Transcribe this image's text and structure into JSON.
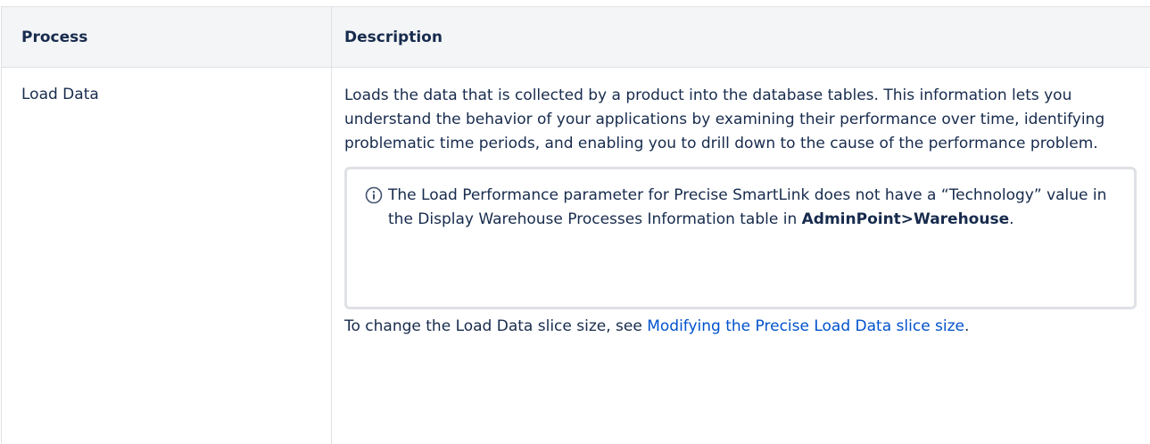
{
  "table": {
    "headers": {
      "process": "Process",
      "description": "Description"
    },
    "rows": [
      {
        "process": "Load Data",
        "description": "Loads the data that is collected by a product into the database tables. This information lets you understand the behavior of your applications by examining their performance over time, identifying problematic time periods, and enabling you to drill down to the cause of the performance problem.",
        "info_panel": {
          "icon": "info-icon",
          "text_before": "The Load Performance parameter for Precise SmartLink does not have a “Technology” value in the Display Warehouse Processes Information table in ",
          "text_bold": "AdminPoint>Warehouse",
          "text_after": "."
        },
        "change_text": "To change the Load Data slice size, see ",
        "link_text": "Modifying the Precise Load Data slice size",
        "change_text_end": "."
      }
    ]
  },
  "colors": {
    "header_bg": "#f4f5f7",
    "border": "#dfe1e6",
    "text": "#172b4d",
    "link": "#0052cc"
  }
}
